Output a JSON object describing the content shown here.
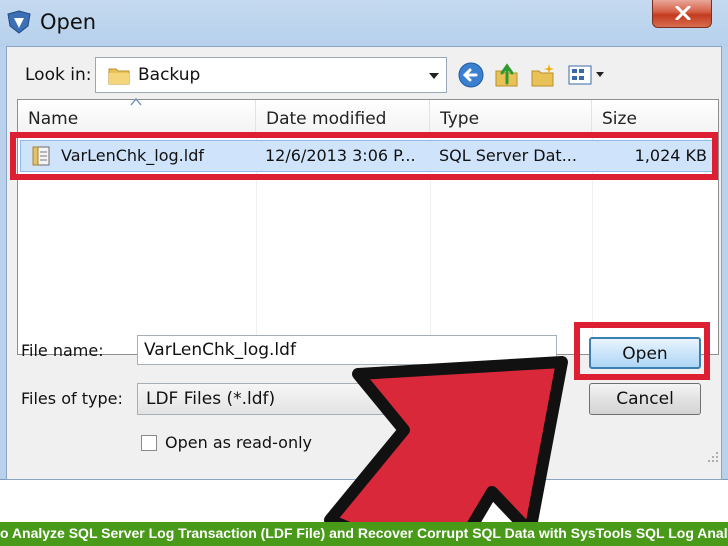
{
  "window": {
    "title": "Open"
  },
  "toolbar": {
    "lookin_label": "Look in:",
    "lookin_value": "Backup",
    "icons": [
      "back-icon",
      "up-folder-icon",
      "new-folder-icon",
      "view-menu-icon"
    ]
  },
  "list": {
    "columns": [
      "Name",
      "Date modified",
      "Type",
      "Size"
    ],
    "rows": [
      {
        "name": "VarLenChk_log.ldf",
        "date": "12/6/2013 3:06 P...",
        "type": "SQL Server Dat...",
        "size": "1,024 KB"
      }
    ]
  },
  "form": {
    "filename_label": "File name:",
    "filename_value": "VarLenChk_log.ldf",
    "filetype_label": "Files of type:",
    "filetype_value": "LDF Files (*.ldf)",
    "readonly_label": "Open as read-only",
    "readonly_checked": false,
    "open_label": "Open",
    "cancel_label": "Cancel"
  },
  "caption": {
    "text": "o Analyze SQL Server Log Transaction (LDF File) and Recover Corrupt SQL Data with SysTools SQL Log Analyzer"
  },
  "colors": {
    "highlight": "#dc1f32",
    "arrow": "#d8283a",
    "caption_bg": "#4a9a1a"
  }
}
